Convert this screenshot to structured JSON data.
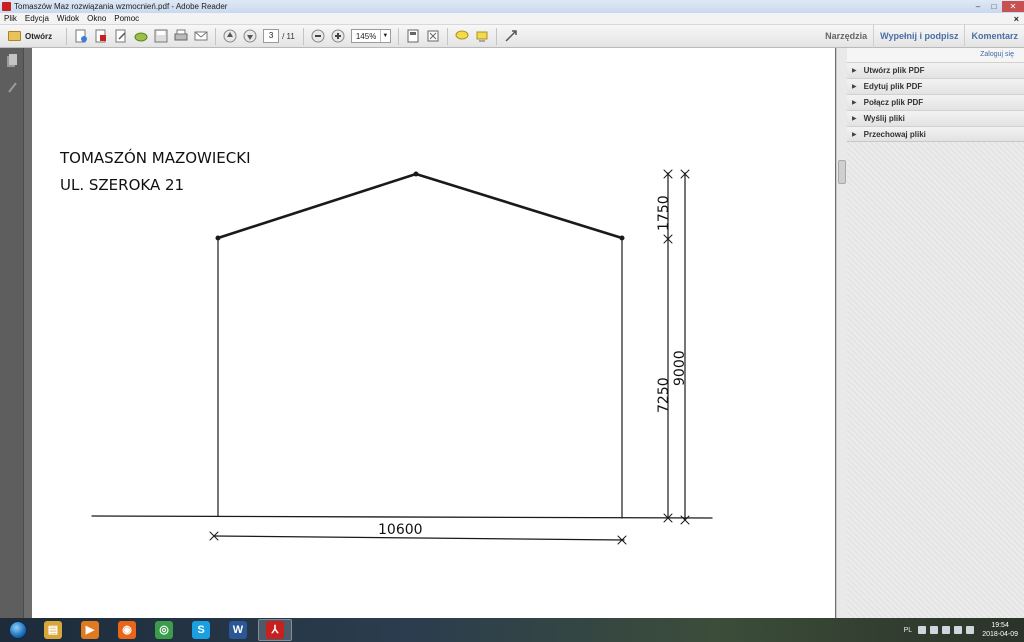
{
  "window": {
    "title": "Tomaszów Maz rozwiązania wzmocnień.pdf - Adobe Reader",
    "controls": {
      "minimize": "–",
      "maximize": "□",
      "close": "✕"
    }
  },
  "menu": {
    "items": [
      "Plik",
      "Edycja",
      "Widok",
      "Okno",
      "Pomoc"
    ],
    "doc_close": "×"
  },
  "toolbar": {
    "open_label": "Otwórz",
    "page_current": "3",
    "page_total": "/ 11",
    "zoom": "145%",
    "right_links": [
      "Narzędzia",
      "Wypełnij i podpisz",
      "Komentarz"
    ]
  },
  "right_panel": {
    "login": "Zaloguj się",
    "items": [
      "Utwórz plik PDF",
      "Edytuj plik PDF",
      "Połącz plik PDF",
      "Wyślij pliki",
      "Przechowaj pliki"
    ]
  },
  "drawing": {
    "line1": "TOMASZÓN MAZOWIECKI",
    "line2": "UL. SZEROKA 21",
    "dim_width": "10600",
    "dim_roof": "1750",
    "dim_wall": "7250",
    "dim_total": "9000"
  },
  "taskbar": {
    "apps": [
      {
        "name": "explorer",
        "glyph": "▤",
        "color": "#d9a63a"
      },
      {
        "name": "media-player",
        "glyph": "▶",
        "color": "#e07a1f"
      },
      {
        "name": "firefox",
        "glyph": "◉",
        "color": "#e8661a"
      },
      {
        "name": "chrome",
        "glyph": "◎",
        "color": "#3b9d4a"
      },
      {
        "name": "skype",
        "glyph": "S",
        "color": "#1aa0e0"
      },
      {
        "name": "word",
        "glyph": "W",
        "color": "#2b5797"
      },
      {
        "name": "adobe-reader",
        "glyph": "⅄",
        "color": "#c7201e"
      }
    ],
    "lang": "PL",
    "time": "19:54",
    "date": "2018-04-09"
  }
}
